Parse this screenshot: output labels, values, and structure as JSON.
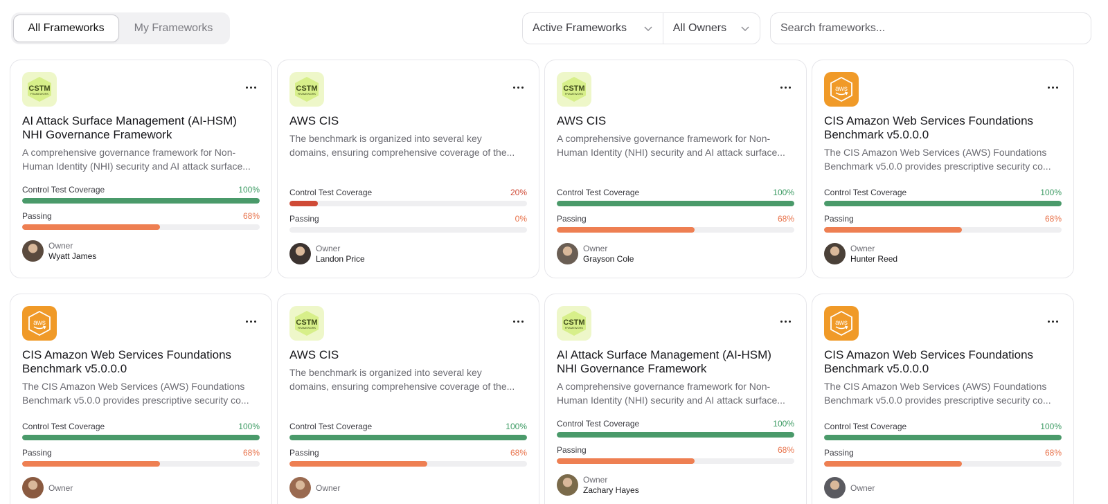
{
  "toolbar": {
    "tabs": [
      "All Frameworks",
      "My Frameworks"
    ],
    "filters": [
      "Active Frameworks",
      "All Owners"
    ],
    "search_placeholder": "Search frameworks..."
  },
  "labels": {
    "coverage": "Control Test Coverage",
    "passing": "Passing",
    "owner": "Owner"
  },
  "logos": {
    "cstm": "CSTM",
    "cstm_sub": "FRAMEWORK",
    "aws": "aws"
  },
  "colors": {
    "green": "#4a9a6a",
    "orange": "#ee7f52",
    "red": "#cf4a36",
    "cstm_bg": "#eef7c9",
    "aws_bg": "#f09a28"
  },
  "cards": [
    {
      "logo": "cstm",
      "title_lines": [
        "AI Attack Surface Management (AI-HSM)",
        "NHI Governance Framework"
      ],
      "desc_lines": [
        "A comprehensive governance framework for Non-",
        "Human Identity (NHI) security and AI attack surface..."
      ],
      "coverage": "100%",
      "coverage_level": 1.0,
      "coverage_color": "green",
      "passing": "68%",
      "passing_level": 0.58,
      "owner": "Wyatt James"
    },
    {
      "logo": "cstm",
      "title_lines": [
        "AWS CIS"
      ],
      "desc_lines": [
        "The benchmark is organized into several key",
        "domains, ensuring comprehensive coverage of the..."
      ],
      "coverage": "20%",
      "coverage_level": 0.12,
      "coverage_color": "red",
      "passing": "0%",
      "passing_level": 0,
      "owner": "Landon Price"
    },
    {
      "logo": "cstm",
      "title_lines": [
        "AWS CIS"
      ],
      "desc_lines": [
        "A comprehensive governance framework for Non-",
        "Human Identity (NHI) security and AI attack surface..."
      ],
      "coverage": "100%",
      "coverage_level": 1.0,
      "coverage_color": "green",
      "passing": "68%",
      "passing_level": 0.58,
      "owner": "Grayson Cole"
    },
    {
      "logo": "aws",
      "title_lines": [
        "CIS Amazon Web Services Foundations",
        "Benchmark v5.0.0.0"
      ],
      "desc_lines": [
        "The CIS Amazon Web Services (AWS) Foundations",
        "Benchmark v5.0.0 provides prescriptive security co..."
      ],
      "coverage": "100%",
      "coverage_level": 1.0,
      "coverage_color": "green",
      "passing": "68%",
      "passing_level": 0.58,
      "owner": "Hunter Reed"
    },
    {
      "logo": "aws",
      "title_lines": [
        "CIS Amazon Web Services Foundations",
        "Benchmark v5.0.0.0"
      ],
      "desc_lines": [
        "The CIS Amazon Web Services (AWS) Foundations",
        "Benchmark v5.0.0 provides prescriptive security co..."
      ],
      "coverage": "100%",
      "coverage_level": 1.0,
      "coverage_color": "green",
      "passing": "68%",
      "passing_level": 0.58,
      "owner": ""
    },
    {
      "logo": "cstm",
      "title_lines": [
        "AWS CIS"
      ],
      "desc_lines": [
        "The benchmark is organized into several key",
        "domains, ensuring comprehensive coverage of the..."
      ],
      "coverage": "100%",
      "coverage_level": 1.0,
      "coverage_color": "green",
      "passing": "68%",
      "passing_level": 0.58,
      "owner": ""
    },
    {
      "logo": "cstm",
      "title_lines": [
        "AI Attack Surface Management (AI-HSM)",
        "NHI Governance Framework"
      ],
      "desc_lines": [
        "A comprehensive governance framework for Non-",
        "Human Identity (NHI) security and AI attack surface..."
      ],
      "coverage": "100%",
      "coverage_level": 1.0,
      "coverage_color": "green",
      "passing": "68%",
      "passing_level": 0.58,
      "owner": "Zachary Hayes"
    },
    {
      "logo": "aws",
      "title_lines": [
        "CIS Amazon Web Services Foundations",
        "Benchmark v5.0.0.0"
      ],
      "desc_lines": [
        "The CIS Amazon Web Services (AWS) Foundations",
        "Benchmark v5.0.0 provides prescriptive security co..."
      ],
      "coverage": "100%",
      "coverage_level": 1.0,
      "coverage_color": "green",
      "passing": "68%",
      "passing_level": 0.58,
      "owner": ""
    }
  ]
}
